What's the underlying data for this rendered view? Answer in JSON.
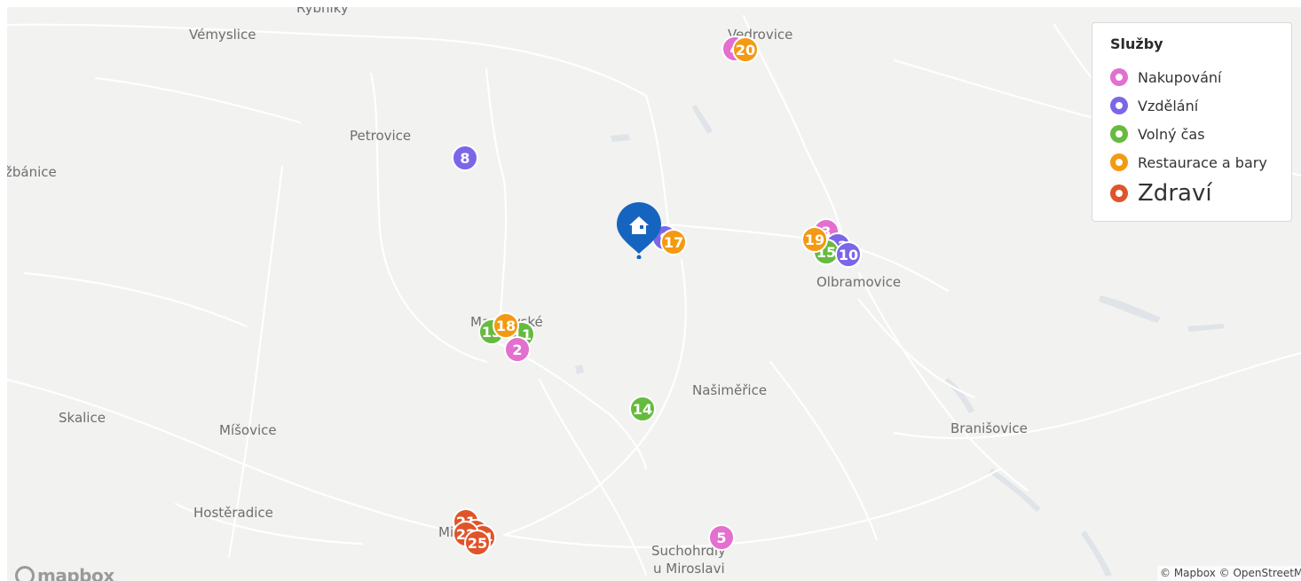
{
  "map": {
    "places": [
      {
        "id": "rybniky",
        "label": "Rybníky"
      },
      {
        "id": "vemyslice",
        "label": "Vémyslice"
      },
      {
        "id": "vedrovice",
        "label": "Vedrovice"
      },
      {
        "id": "petrovice",
        "label": "Petrovice"
      },
      {
        "id": "zbanice",
        "label": "žbánice"
      },
      {
        "id": "olbramovice",
        "label": "Olbramovice"
      },
      {
        "id": "mackovske",
        "label": "Mackovské"
      },
      {
        "id": "nasimerice",
        "label": "Našiměřice"
      },
      {
        "id": "branisovice",
        "label": "Branišovice"
      },
      {
        "id": "skalice",
        "label": "Skalice"
      },
      {
        "id": "misovice",
        "label": "Míšovice"
      },
      {
        "id": "hosteradice",
        "label": "Hostěradice"
      },
      {
        "id": "miroslav",
        "label": "Miroslav"
      },
      {
        "id": "suchohrdly1",
        "label": "Suchohrdly"
      },
      {
        "id": "suchohrdly2",
        "label": "u Miroslavi"
      }
    ],
    "markers": [
      {
        "label": "4",
        "category": "nakupovani"
      },
      {
        "label": "20",
        "category": "restaurace"
      },
      {
        "label": "8",
        "category": "vzdelani"
      },
      {
        "label": "9",
        "category": "vzdelani"
      },
      {
        "label": "17",
        "category": "restaurace"
      },
      {
        "label": "3",
        "category": "nakupovani"
      },
      {
        "label": "12",
        "category": "vzdelani"
      },
      {
        "label": "15",
        "category": "volny_cas"
      },
      {
        "label": "19",
        "category": "restaurace"
      },
      {
        "label": "10",
        "category": "vzdelani"
      },
      {
        "label": "13",
        "category": "volny_cas"
      },
      {
        "label": "11",
        "category": "volny_cas"
      },
      {
        "label": "2",
        "category": "nakupovani"
      },
      {
        "label": "18",
        "category": "restaurace"
      },
      {
        "label": "14",
        "category": "volny_cas"
      },
      {
        "label": "5",
        "category": "nakupovani"
      },
      {
        "label": "21",
        "category": "zdravi"
      },
      {
        "label": "23",
        "category": "zdravi"
      },
      {
        "label": "24",
        "category": "zdravi"
      },
      {
        "label": "22",
        "category": "zdravi"
      },
      {
        "label": "25",
        "category": "zdravi"
      }
    ],
    "home_icon": "home-icon"
  },
  "legend": {
    "title": "Služby",
    "items": [
      {
        "key": "nakupovani",
        "label": "Nakupování",
        "color": "#e36fcf",
        "icon": "cart-icon"
      },
      {
        "key": "vzdelani",
        "label": "Vzdělání",
        "color": "#7b66e8",
        "icon": "school-icon"
      },
      {
        "key": "volny_cas",
        "label": "Volný čas",
        "color": "#66bb3f",
        "icon": "leaf-icon"
      },
      {
        "key": "restaurace",
        "label": "Restaurace a bary",
        "color": "#f39a12",
        "icon": "fork-knife-icon"
      },
      {
        "key": "zdravi",
        "label": "Zdraví",
        "color": "#e0542a",
        "icon": "heart-icon"
      }
    ]
  },
  "colors": {
    "home": "#1565c0",
    "background": "#f2f2f0"
  },
  "footer": {
    "logo": "mapbox",
    "attribution": "© Mapbox © OpenStreetMap"
  }
}
